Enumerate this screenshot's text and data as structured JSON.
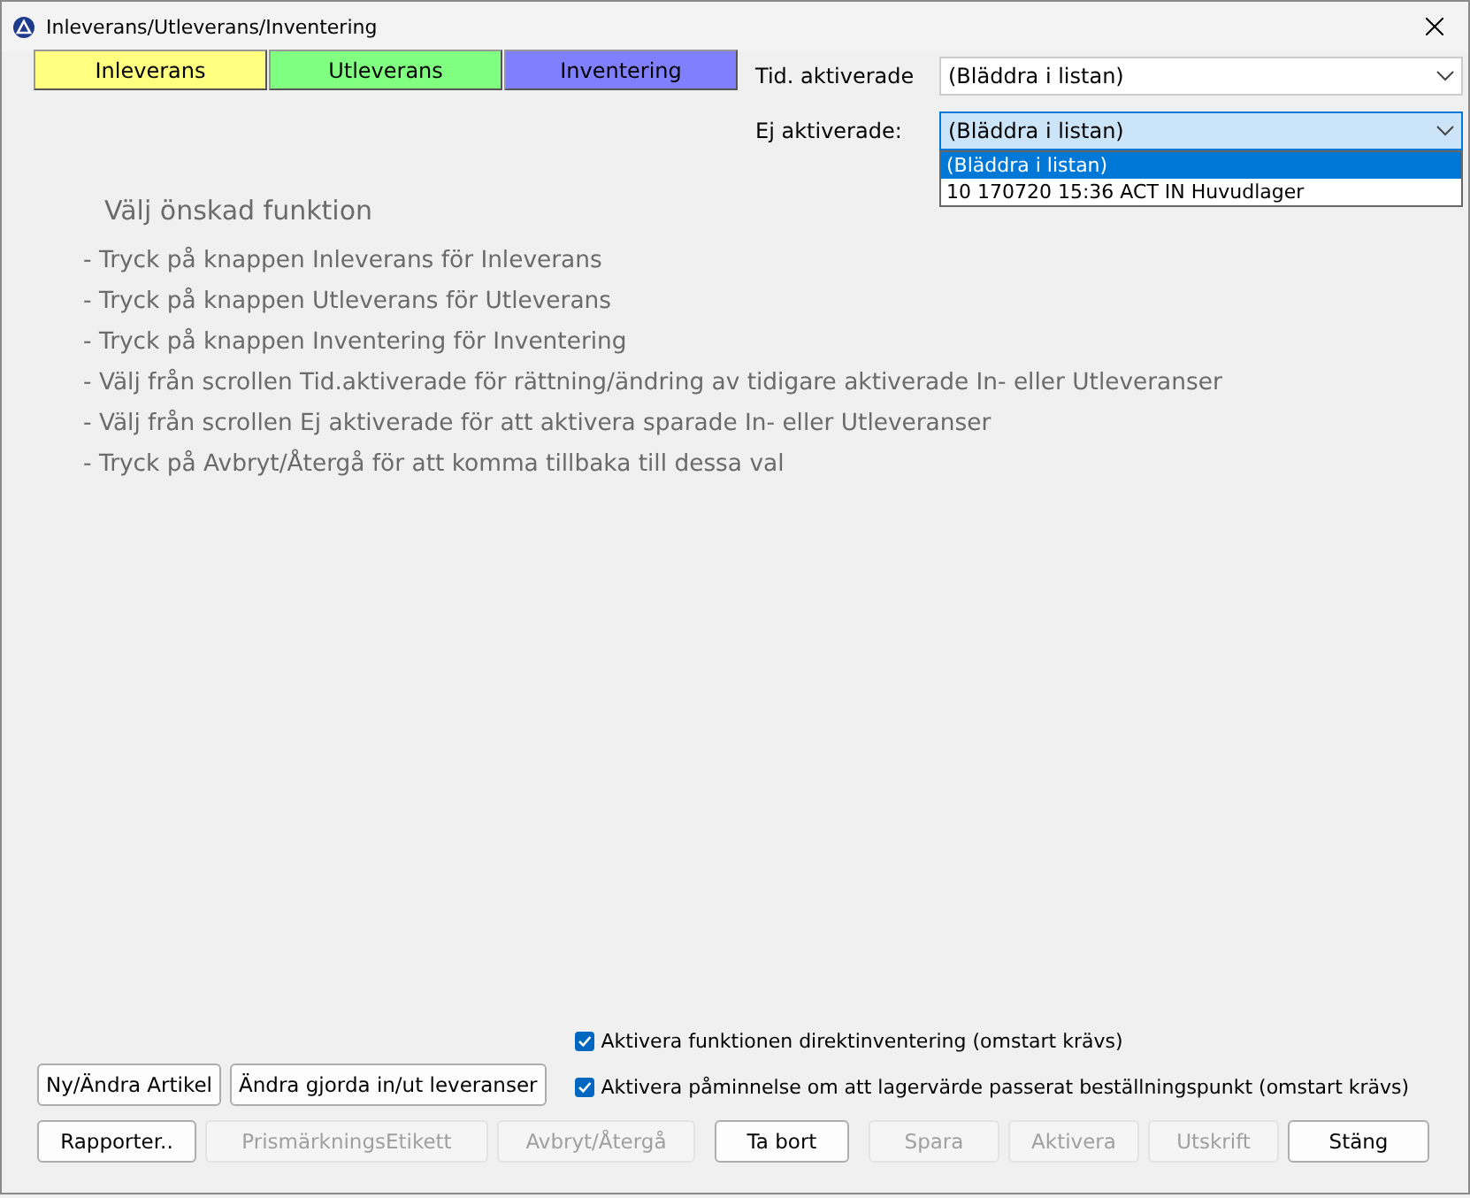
{
  "window": {
    "title": "Inleverans/Utleverans/Inventering"
  },
  "mode_buttons": [
    {
      "label": "Inleverans",
      "color": "#ffff80"
    },
    {
      "label": "Utleverans",
      "color": "#80ff80"
    },
    {
      "label": "Inventering",
      "color": "#8080ff"
    }
  ],
  "selectors": [
    {
      "label": "Tid. aktiverade",
      "value": "(Bläddra i listan)",
      "focused": false
    },
    {
      "label": "Ej aktiverade:",
      "value": "(Bläddra i listan)",
      "focused": true,
      "options": [
        {
          "label": "(Bläddra i listan)",
          "selected": true
        },
        {
          "label": "10 170720 15:36 ACT IN Huvudlager",
          "selected": false
        }
      ]
    }
  ],
  "instructions": {
    "heading": "Välj önskad funktion",
    "lines": [
      "- Tryck på knappen Inleverans för Inleverans",
      "- Tryck på knappen Utleverans för Utleverans",
      "- Tryck på knappen Inventering för Inventering",
      "- Välj från scrollen Tid.aktiverade för rättning/ändring av tidigare aktiverade In- eller Utleveranser",
      "- Välj från scrollen Ej aktiverade för att aktivera sparade In- eller Utleveranser",
      "- Tryck på Avbryt/Återgå för att komma tillbaka till dessa val"
    ]
  },
  "side_buttons": [
    "Ny/Ändra Artikel",
    "Ändra gjorda in/ut leveranser"
  ],
  "checkboxes": [
    {
      "label": "Aktivera funktionen direktinventering (omstart krävs)",
      "checked": true
    },
    {
      "label": "Aktivera påminnelse om att lagervärde passerat beställningspunkt (omstart krävs)",
      "checked": true
    }
  ],
  "action_buttons": [
    {
      "label": "Rapporter..",
      "disabled": false
    },
    {
      "label": "PrismärkningsEtikett",
      "disabled": true
    },
    {
      "label": "Avbryt/Återgå",
      "disabled": true
    },
    {
      "label": "Ta bort",
      "disabled": false
    },
    {
      "label": "Spara",
      "disabled": true
    },
    {
      "label": "Aktivera",
      "disabled": true
    },
    {
      "label": "Utskrift",
      "disabled": true
    },
    {
      "label": "Stäng",
      "disabled": false
    }
  ]
}
